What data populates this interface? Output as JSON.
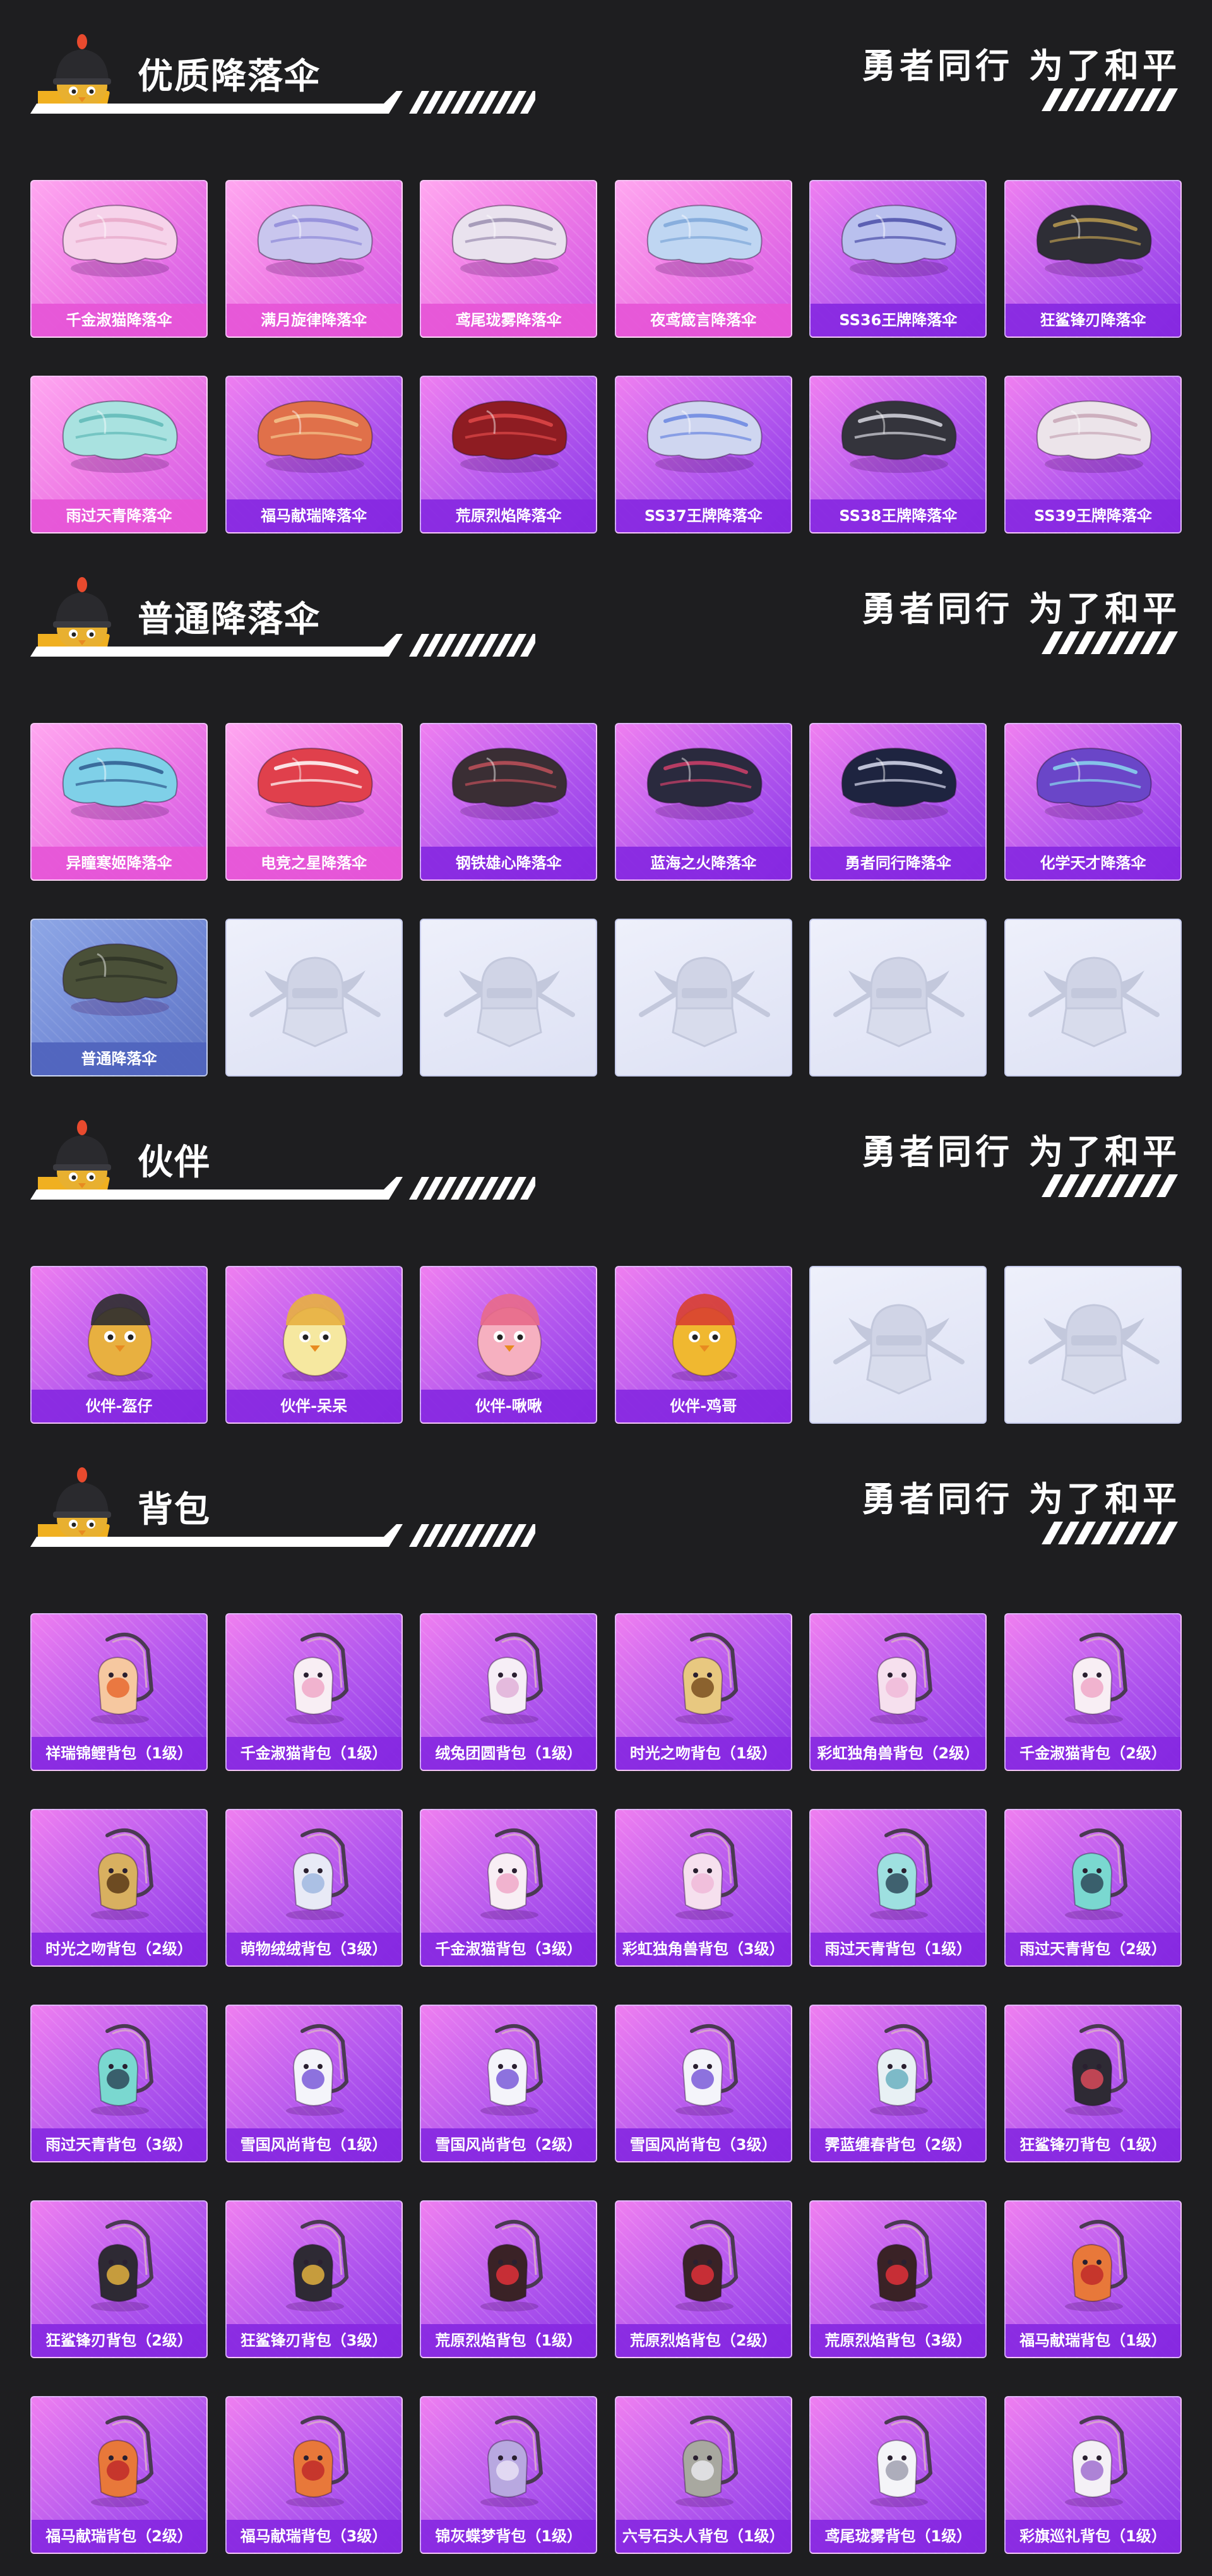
{
  "slogan": "勇者同行 为了和平",
  "colors": {
    "background": "#1e1e20",
    "card_pink": "#f07ee6",
    "card_purple": "#b458ee",
    "card_blue": "#6f86d4",
    "card_empty": "#e6e9f8",
    "label_pink": "#e655d7",
    "label_purple": "#8728e1"
  },
  "sections": [
    {
      "title": "优质降落伞",
      "items": [
        {
          "name": "千金淑猫降落伞",
          "style": "pink",
          "icon": "parachute-icon",
          "color": "#f6d3ea",
          "accent": "#e7a7c8"
        },
        {
          "name": "满月旋律降落伞",
          "style": "pink",
          "icon": "parachute-icon",
          "color": "#c9c6ee",
          "accent": "#8f8ad8"
        },
        {
          "name": "鸢尾珑雾降落伞",
          "style": "pink",
          "icon": "parachute-icon",
          "color": "#e9e2ee",
          "accent": "#9b8fb0"
        },
        {
          "name": "夜鸢箴言降落伞",
          "style": "pink",
          "icon": "parachute-icon",
          "color": "#bfd6f2",
          "accent": "#7ea7d9"
        },
        {
          "name": "SS36王牌降落伞",
          "style": "purple",
          "icon": "parachute-icon",
          "color": "#b9c0ee",
          "accent": "#4b4fa8"
        },
        {
          "name": "狂鲨锋刃降落伞",
          "style": "purple",
          "icon": "parachute-icon",
          "color": "#2e2e36",
          "accent": "#b89a50"
        },
        {
          "name": "雨过天青降落伞",
          "style": "pink",
          "icon": "parachute-icon",
          "color": "#a9e2e0",
          "accent": "#5fb9b6"
        },
        {
          "name": "福马献瑞降落伞",
          "style": "purple",
          "icon": "parachute-icon",
          "color": "#e0704a",
          "accent": "#f3c48c"
        },
        {
          "name": "荒原烈焰降落伞",
          "style": "purple",
          "icon": "parachute-icon",
          "color": "#8e1c22",
          "accent": "#e04848"
        },
        {
          "name": "SS37王牌降落伞",
          "style": "purple",
          "icon": "parachute-icon",
          "color": "#cfd6f0",
          "accent": "#6a86e0"
        },
        {
          "name": "SS38王牌降落伞",
          "style": "purple",
          "icon": "parachute-icon",
          "color": "#34343c",
          "accent": "#d8d8e0"
        },
        {
          "name": "SS39王牌降落伞",
          "style": "purple",
          "icon": "parachute-icon",
          "color": "#ece4ea",
          "accent": "#c8a6b6"
        }
      ]
    },
    {
      "title": "普通降落伞",
      "items": [
        {
          "name": "异瞳寒姬降落伞",
          "style": "pink",
          "icon": "parachute-icon",
          "color": "#7fd0e8",
          "accent": "#2e5a8e"
        },
        {
          "name": "电竞之星降落伞",
          "style": "pink",
          "icon": "parachute-icon",
          "color": "#e0404c",
          "accent": "#ffffff"
        },
        {
          "name": "钢铁雄心降落伞",
          "style": "purple",
          "icon": "parachute-icon",
          "color": "#3a2e34",
          "accent": "#c0505a"
        },
        {
          "name": "蓝海之火降落伞",
          "style": "purple",
          "icon": "parachute-icon",
          "color": "#2a2a3e",
          "accent": "#d0406a"
        },
        {
          "name": "勇者同行降落伞",
          "style": "purple",
          "icon": "parachute-icon",
          "color": "#1e2440",
          "accent": "#d8dcf0"
        },
        {
          "name": "化学天才降落伞",
          "style": "purple",
          "icon": "parachute-icon",
          "color": "#6a46c8",
          "accent": "#8ad8ee"
        },
        {
          "name": "普通降落伞",
          "style": "blue",
          "icon": "parachute-icon",
          "color": "#4a5038",
          "accent": "#2e3226"
        },
        {
          "name": "",
          "style": "empty",
          "icon": "placeholder-emblem-icon"
        },
        {
          "name": "",
          "style": "empty",
          "icon": "placeholder-emblem-icon"
        },
        {
          "name": "",
          "style": "empty",
          "icon": "placeholder-emblem-icon"
        },
        {
          "name": "",
          "style": "empty",
          "icon": "placeholder-emblem-icon"
        },
        {
          "name": "",
          "style": "empty",
          "icon": "placeholder-emblem-icon"
        }
      ]
    },
    {
      "title": "伙伴",
      "items": [
        {
          "name": "伙伴-盔仔",
          "style": "purple",
          "icon": "companion-icon",
          "color": "#e8b040",
          "accent": "#2e2e2e"
        },
        {
          "name": "伙伴-呆呆",
          "style": "purple",
          "icon": "companion-icon",
          "color": "#f6e8a0",
          "accent": "#e8b040"
        },
        {
          "name": "伙伴-啾啾",
          "style": "purple",
          "icon": "companion-icon",
          "color": "#f6b0c0",
          "accent": "#e86a8a"
        },
        {
          "name": "伙伴-鸡哥",
          "style": "purple",
          "icon": "companion-icon",
          "color": "#f0b830",
          "accent": "#d84030"
        },
        {
          "name": "",
          "style": "empty",
          "icon": "placeholder-emblem-icon"
        },
        {
          "name": "",
          "style": "empty",
          "icon": "placeholder-emblem-icon"
        }
      ]
    },
    {
      "title": "背包",
      "items": [
        {
          "name": "祥瑞锦鲤背包（1级）",
          "style": "purple",
          "icon": "backpack-icon",
          "color": "#f6c8a0",
          "accent": "#e86a30"
        },
        {
          "name": "千金淑猫背包（1级）",
          "style": "purple",
          "icon": "backpack-icon",
          "color": "#f8eef4",
          "accent": "#f0a8c8"
        },
        {
          "name": "绒兔团圆背包（1级）",
          "style": "purple",
          "icon": "backpack-icon",
          "color": "#f6eef6",
          "accent": "#e0b0d8"
        },
        {
          "name": "时光之吻背包（1级）",
          "style": "purple",
          "icon": "backpack-icon",
          "color": "#e8c880",
          "accent": "#7a5020"
        },
        {
          "name": "彩虹独角兽背包（2级）",
          "style": "purple",
          "icon": "backpack-icon",
          "color": "#f6e0ee",
          "accent": "#f0b8d8"
        },
        {
          "name": "千金淑猫背包（2级）",
          "style": "purple",
          "icon": "backpack-icon",
          "color": "#f8eef4",
          "accent": "#f0a8c8"
        },
        {
          "name": "时光之吻背包（2级）",
          "style": "purple",
          "icon": "backpack-icon",
          "color": "#d8b060",
          "accent": "#5a3a18"
        },
        {
          "name": "萌物绒绒背包（3级）",
          "style": "purple",
          "icon": "backpack-icon",
          "color": "#e8eaf6",
          "accent": "#a0b8e0"
        },
        {
          "name": "千金淑猫背包（3级）",
          "style": "purple",
          "icon": "backpack-icon",
          "color": "#f8eef4",
          "accent": "#f0a8c8"
        },
        {
          "name": "彩虹独角兽背包（3级）",
          "style": "purple",
          "icon": "backpack-icon",
          "color": "#f6e0ee",
          "accent": "#f0b8d8"
        },
        {
          "name": "雨过天青背包（1级）",
          "style": "purple",
          "icon": "backpack-icon",
          "color": "#9ee0e0",
          "accent": "#2e4a5a"
        },
        {
          "name": "雨过天青背包（2级）",
          "style": "purple",
          "icon": "backpack-icon",
          "color": "#7ad8d0",
          "accent": "#2e4a5a"
        },
        {
          "name": "雨过天青背包（3级）",
          "style": "purple",
          "icon": "backpack-icon",
          "color": "#7ad8d0",
          "accent": "#2e4a5a"
        },
        {
          "name": "雪国风尚背包（1级）",
          "style": "purple",
          "icon": "backpack-icon",
          "color": "#f4f4fa",
          "accent": "#7a5ad8"
        },
        {
          "name": "雪国风尚背包（2级）",
          "style": "purple",
          "icon": "backpack-icon",
          "color": "#f4f4fa",
          "accent": "#7a5ad8"
        },
        {
          "name": "雪国风尚背包（3级）",
          "style": "purple",
          "icon": "backpack-icon",
          "color": "#f4f4fa",
          "accent": "#7a5ad8"
        },
        {
          "name": "霁蓝缠春背包（2级）",
          "style": "purple",
          "icon": "backpack-icon",
          "color": "#e8f0f4",
          "accent": "#6ab0c0"
        },
        {
          "name": "狂鲨锋刃背包（1级）",
          "style": "purple",
          "icon": "backpack-icon",
          "color": "#2e2a34",
          "accent": "#d84a5a"
        },
        {
          "name": "狂鲨锋刃背包（2级）",
          "style": "purple",
          "icon": "backpack-icon",
          "color": "#2e2a34",
          "accent": "#e0b040"
        },
        {
          "name": "狂鲨锋刃背包（3级）",
          "style": "purple",
          "icon": "backpack-icon",
          "color": "#2e2a34",
          "accent": "#e0b040"
        },
        {
          "name": "荒原烈焰背包（1级）",
          "style": "purple",
          "icon": "backpack-icon",
          "color": "#3a2226",
          "accent": "#e0303a"
        },
        {
          "name": "荒原烈焰背包（2级）",
          "style": "purple",
          "icon": "backpack-icon",
          "color": "#3a2226",
          "accent": "#e0303a"
        },
        {
          "name": "荒原烈焰背包（3级）",
          "style": "purple",
          "icon": "backpack-icon",
          "color": "#3a2226",
          "accent": "#e0303a"
        },
        {
          "name": "福马献瑞背包（1级）",
          "style": "purple",
          "icon": "backpack-icon",
          "color": "#e8783a",
          "accent": "#c02a2a"
        },
        {
          "name": "福马献瑞背包（2级）",
          "style": "purple",
          "icon": "backpack-icon",
          "color": "#e8783a",
          "accent": "#c02a2a"
        },
        {
          "name": "福马献瑞背包（3级）",
          "style": "purple",
          "icon": "backpack-icon",
          "color": "#e8783a",
          "accent": "#c02a2a"
        },
        {
          "name": "锦灰蝶梦背包（1级）",
          "style": "purple",
          "icon": "backpack-icon",
          "color": "#b8a8e0",
          "accent": "#e8e0f4"
        },
        {
          "name": "六号石头人背包（1级）",
          "style": "purple",
          "icon": "backpack-icon",
          "color": "#a8a8a0",
          "accent": "#e8e8ec"
        },
        {
          "name": "鸢尾珑雾背包（1级）",
          "style": "purple",
          "icon": "backpack-icon",
          "color": "#f4f4f8",
          "accent": "#a0a0b0"
        },
        {
          "name": "彩旗巡礼背包（1级）",
          "style": "purple",
          "icon": "backpack-icon",
          "color": "#f4f0f6",
          "accent": "#a070d0"
        }
      ]
    }
  ]
}
